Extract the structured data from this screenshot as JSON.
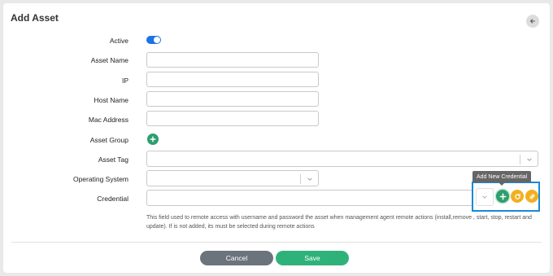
{
  "page": {
    "title": "Add Asset"
  },
  "form": {
    "active_label": "Active",
    "active_value": true,
    "asset_name_label": "Asset Name",
    "asset_name_value": "",
    "ip_label": "IP",
    "ip_value": "",
    "host_name_label": "Host Name",
    "host_name_value": "",
    "mac_address_label": "Mac Address",
    "mac_address_value": "",
    "asset_group_label": "Asset Group",
    "asset_tag_label": "Asset Tag",
    "operating_system_label": "Operating System",
    "credential_label": "Credential",
    "credential_help": "This field used to remote access with username and password the asset when management agent remote actions (install,remove , start, stop, restart and update). If is not added, its must be selected during remote actions"
  },
  "tooltip": {
    "add_credential": "Add New Credential"
  },
  "footer": {
    "cancel_label": "Cancel",
    "save_label": "Save"
  },
  "colors": {
    "toggle": "#1a73e8",
    "add_green": "#2e9e6f",
    "action_yellow": "#f2b01e",
    "save_button": "#2fb27a",
    "cancel_button": "#6b737c",
    "highlight_border": "#1a8ad8"
  },
  "icons": {
    "back": "arrow-left-icon",
    "add": "plus-icon",
    "refresh": "refresh-icon",
    "link": "link-icon",
    "dropdown": "chevron-down-icon"
  }
}
